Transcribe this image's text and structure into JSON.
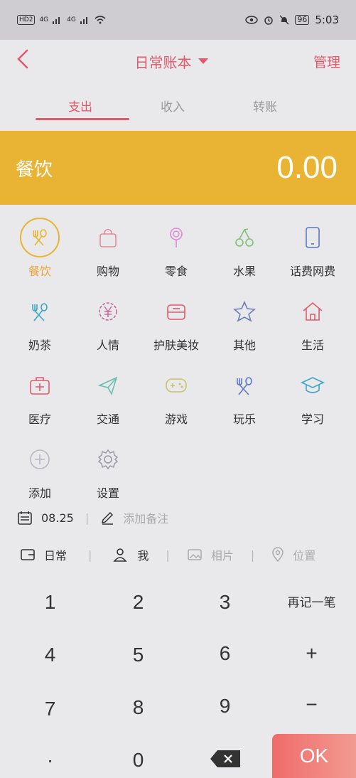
{
  "status_bar": {
    "left": [
      "HD2",
      "4G",
      "4G"
    ],
    "battery": "96",
    "time": "5:03"
  },
  "header": {
    "back_icon": "chevron-left-icon",
    "title": "日常账本",
    "manage_label": "管理"
  },
  "tabs": [
    {
      "label": "支出"
    },
    {
      "label": "收入"
    },
    {
      "label": "转账"
    }
  ],
  "amount_bar": {
    "category": "餐饮",
    "amount": "0.00"
  },
  "categories": [
    {
      "label": "餐饮",
      "icon": "utensils-icon"
    },
    {
      "label": "购物",
      "icon": "shopping-bag-icon"
    },
    {
      "label": "零食",
      "icon": "lollipop-icon"
    },
    {
      "label": "水果",
      "icon": "cherry-icon"
    },
    {
      "label": "话费网费",
      "icon": "phone-icon"
    },
    {
      "label": "奶茶",
      "icon": "utensils-icon"
    },
    {
      "label": "人情",
      "icon": "yuan-icon"
    },
    {
      "label": "护肤美妆",
      "icon": "makeup-icon"
    },
    {
      "label": "其他",
      "icon": "star-icon"
    },
    {
      "label": "生活",
      "icon": "house-icon"
    },
    {
      "label": "医疗",
      "icon": "medical-kit-icon"
    },
    {
      "label": "交通",
      "icon": "paper-plane-icon"
    },
    {
      "label": "游戏",
      "icon": "gamepad-icon"
    },
    {
      "label": "玩乐",
      "icon": "utensils-icon"
    },
    {
      "label": "学习",
      "icon": "graduation-cap-icon"
    },
    {
      "label": "添加",
      "icon": "plus-circle-icon"
    },
    {
      "label": "设置",
      "icon": "gear-icon"
    }
  ],
  "date_row": {
    "date": "08.25",
    "note_placeholder": "添加备注"
  },
  "meta_row": {
    "book": "日常",
    "member": "我",
    "photo": "相片",
    "location": "位置"
  },
  "keypad": {
    "k1": "1",
    "k2": "2",
    "k3": "3",
    "again": "再记一笔",
    "k4": "4",
    "k5": "5",
    "k6": "6",
    "plus": "+",
    "k7": "7",
    "k8": "8",
    "k9": "9",
    "minus": "−",
    "dot": "·",
    "k0": "0",
    "ok": "OK"
  },
  "colors": {
    "accent": "#e05a6c",
    "amount_bar": "#e9b333",
    "ok_button": "#ef6b6b"
  }
}
